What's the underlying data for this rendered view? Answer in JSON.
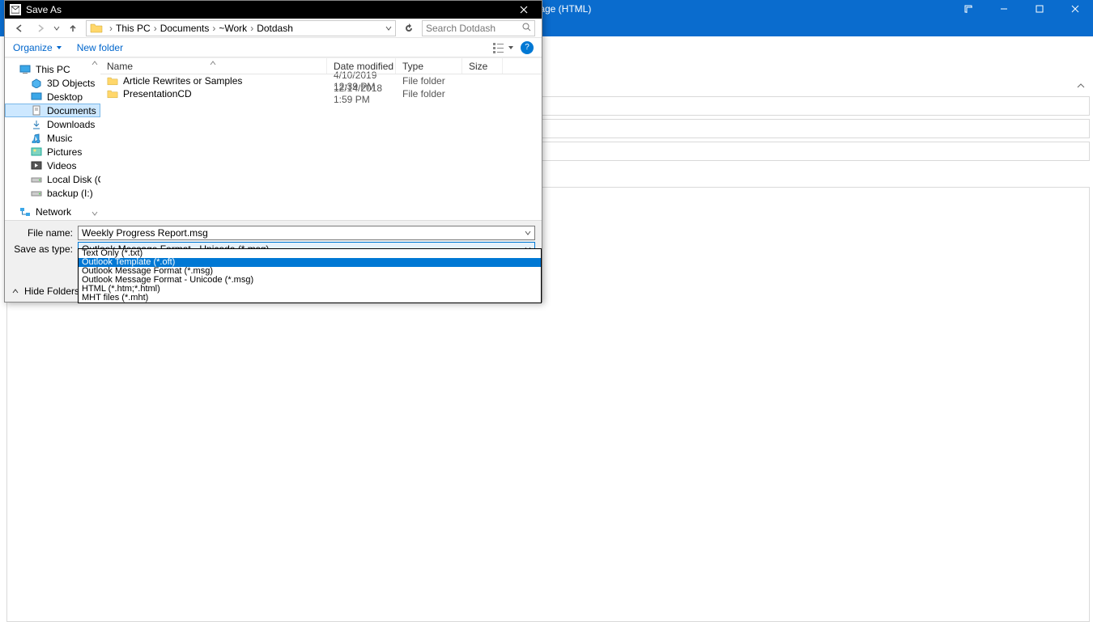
{
  "outlook": {
    "title_suffix": "rt  -  Message (HTML)"
  },
  "saveas": {
    "title": "Save As",
    "breadcrumb": {
      "seg1": "This PC",
      "seg2": "Documents",
      "seg3": "~Work",
      "seg4": "Dotdash"
    },
    "search_placeholder": "Search Dotdash",
    "toolbar": {
      "organize": "Organize",
      "newfolder": "New folder"
    },
    "nav": {
      "thispc": "This PC",
      "objects3d": "3D Objects",
      "desktop": "Desktop",
      "documents": "Documents",
      "downloads": "Downloads",
      "music": "Music",
      "pictures": "Pictures",
      "videos": "Videos",
      "localdisk": "Local Disk (C:)",
      "backup": "backup (I:)",
      "network": "Network"
    },
    "columns": {
      "name": "Name",
      "date": "Date modified",
      "type": "Type",
      "size": "Size"
    },
    "rows": [
      {
        "name": "Article Rewrites or Samples",
        "date": "4/10/2019 12:39 PM",
        "type": "File folder"
      },
      {
        "name": "PresentationCD",
        "date": "12/14/2018 1:59 PM",
        "type": "File folder"
      }
    ],
    "labels": {
      "filename": "File name:",
      "saveastype": "Save as type:"
    },
    "filename": "Weekly Progress Report.msg",
    "saveastype": "Outlook Message Format - Unicode (*.msg)",
    "type_options": {
      "o0": "Text Only (*.txt)",
      "o1": "Outlook Template (*.oft)",
      "o2": "Outlook Message Format (*.msg)",
      "o3": "Outlook Message Format - Unicode (*.msg)",
      "o4": "HTML (*.htm;*.html)",
      "o5": "MHT files (*.mht)"
    },
    "hidefolders": "Hide Folders",
    "help": "?"
  }
}
